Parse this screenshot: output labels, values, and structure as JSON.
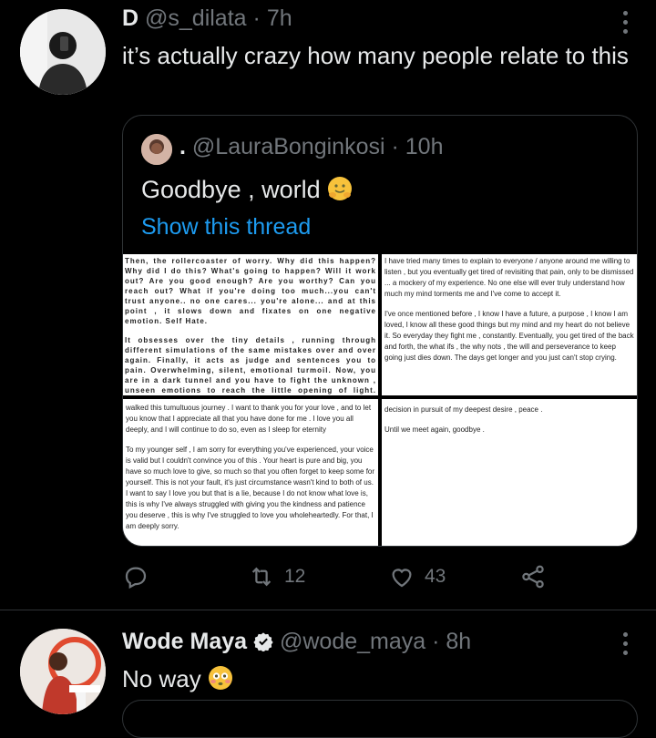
{
  "tweet1": {
    "name": "D",
    "handle": "@s_dilata",
    "dot": "·",
    "time": "7h",
    "text": "it’s actually crazy how many people relate to this",
    "quote": {
      "handle": "@LauraBonginkosi",
      "prefix": ".",
      "dot": "·",
      "time": "10h",
      "text": "Goodbye , world",
      "link": "Show this thread",
      "panels": {
        "p1": [
          "Then, the rollercoaster of worry. Why did this happen? Why did I do this? What's going to happen? Will it work out? Are you good enough? Are you worthy? Can you reach out? What if you're doing too much...you can't trust anyone.. no one cares... you're alone... and at this point , it slows down and fixates on one negative emotion. Self Hate.",
          "It obsesses over the tiny details , running through different simulations of the same mistakes over and over again. Finally, it acts as judge and sentences you to pain. Overwhelming, silent, emotional turmoil. Now, you are in a dark tunnel and you have to fight the unknown , unseen emotions to reach the little opening of light. Peace? Happiness ? Contentment? You never"
        ],
        "p2": [
          "I have tried many times to explain to everyone / anyone around me willing to listen , but you eventually get tired of revisiting that pain, only to be dismissed ... a mockery of my experience. No one else will ever truly understand how much my mind torments me and I've come to accept it.",
          "I've once mentioned before , I know I have a future, a purpose , I know I am loved, I know all these good things but my mind and my heart do not believe it. So everyday they fight me , constantly. Eventually, you get tired of the back and forth, the what ifs , the why nots , the will and perseverance to keep going just dies down. The days get longer and you just can't stop crying."
        ],
        "p3": [
          "walked this tumultuous journey . I want to thank you for your love , and to let you know that I appreciate all that you have done for me . I love you all deeply, and I will continue to do so, even as I sleep for eternity",
          "To my younger self , I am sorry for everything you've experienced, your voice is valid but I couldn't convince you of this . Your heart is pure and big, you have so much love to give, so much so that you often forget to keep some for yourself. This is not your fault, it's just circumstance wasn't kind to both of us. I want to say I love you but that is a lie, because I do not know what love is, this is why I've always struggled with giving you the kindness and patience you deserve , this is why I've struggled to love you wholeheartedly. For that, I am deeply sorry."
        ],
        "p4": [
          "decision in pursuit of my deepest desire , peace .",
          "Until we meet again, goodbye ."
        ]
      }
    },
    "actions": {
      "retweets": "12",
      "likes": "43"
    }
  },
  "tweet2": {
    "name": "Wode Maya",
    "handle": "@wode_maya",
    "dot": "·",
    "time": "8h",
    "text": "No way"
  },
  "icons": {
    "reply": "reply-icon",
    "retweet": "retweet-icon",
    "like": "heart-icon",
    "share": "share-icon",
    "more": "more-options-icon",
    "verified": "verified-badge-icon"
  },
  "colors": {
    "background": "#000000",
    "text": "#e7e9ea",
    "secondary": "#71767b",
    "link": "#1d9bf0",
    "border": "#2f3336"
  }
}
